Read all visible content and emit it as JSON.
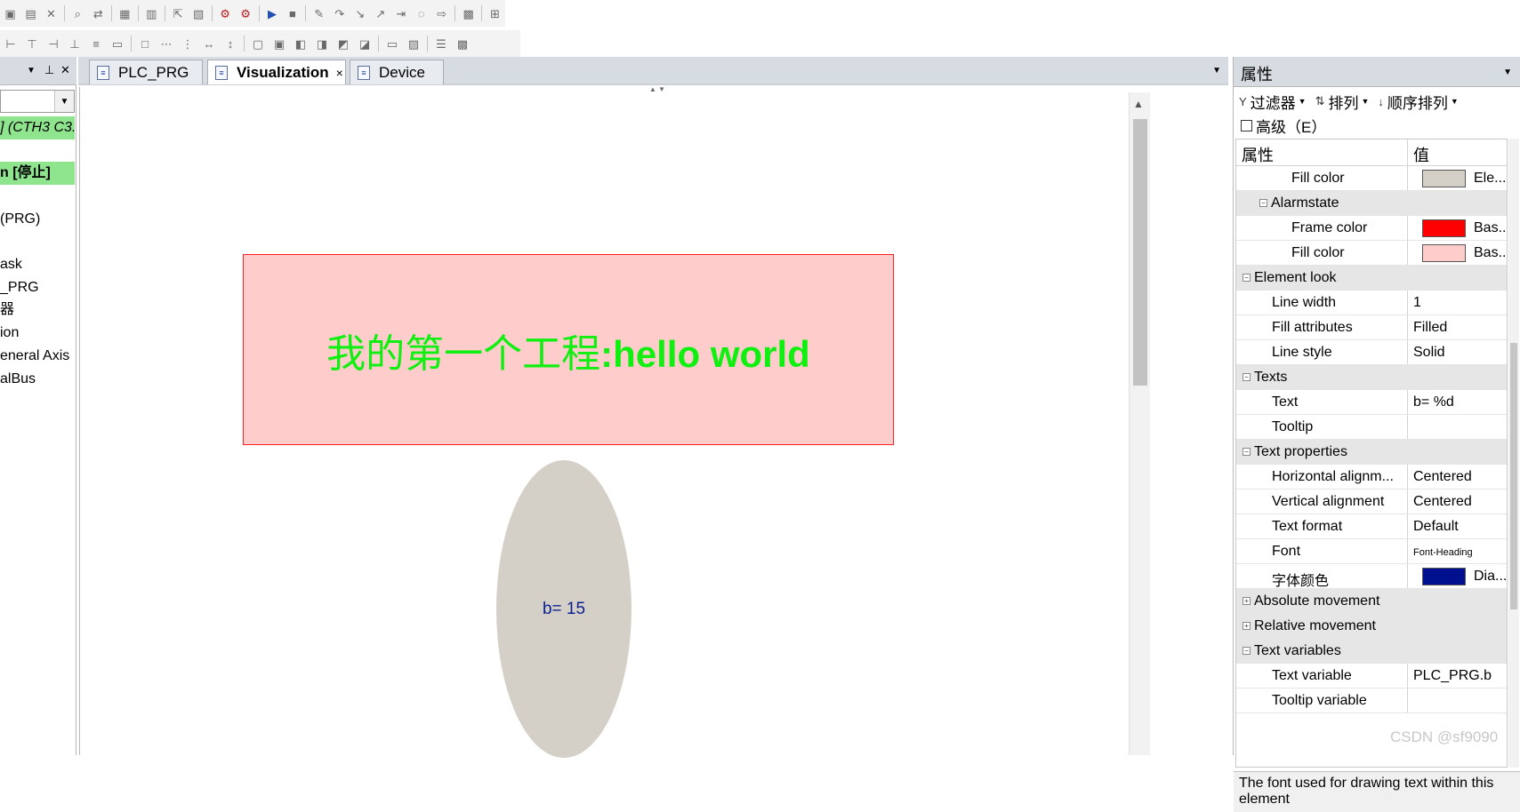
{
  "toolbar": {
    "row1_icons": [
      "paste-icon",
      "paste-special-icon",
      "delete-icon",
      "find-icon",
      "replace-icon",
      "print-icon",
      "add-object-icon",
      "export-icon",
      "monitor-icon",
      "login-icon",
      "logout-icon",
      "start-icon",
      "stop-icon",
      "build-icon",
      "step-over-icon",
      "step-into-icon",
      "step-out-icon",
      "run-to-cursor-icon",
      "breakpoint-icon",
      "next-statement-icon",
      "display-mode-icon",
      "cart-icon"
    ],
    "row2_icons": [
      "align-left-icon",
      "align-center-icon",
      "align-right-icon",
      "align-top-icon",
      "align-middle-icon",
      "align-bottom-icon",
      "same-size-icon",
      "distribute-h-icon",
      "distribute-v-icon",
      "space-h-icon",
      "space-v-icon",
      "group-icon",
      "ungroup-icon",
      "bring-front-icon",
      "send-back-icon",
      "bring-forward-icon",
      "send-backward-icon",
      "frame-icon",
      "background-icon",
      "element-list-icon",
      "config-icon"
    ]
  },
  "left_panel": {
    "tree": [
      {
        "text": "] (CTH3 C3.",
        "style": "green-italic"
      },
      {
        "text": "n [停止]",
        "style": "green-bold"
      },
      {
        "text": "(PRG)",
        "style": "normal"
      },
      {
        "text": "ask",
        "style": "normal"
      },
      {
        "text": "_PRG",
        "style": "normal"
      },
      {
        "text": "器",
        "style": "normal"
      },
      {
        "text": "ion",
        "style": "normal"
      },
      {
        "text": "eneral Axis",
        "style": "normal"
      },
      {
        "text": "alBus",
        "style": "normal"
      }
    ]
  },
  "tabs": [
    {
      "label": "PLC_PRG",
      "active": false,
      "icon": "program-icon"
    },
    {
      "label": "Visualization",
      "active": true,
      "icon": "visualization-icon",
      "close": "×"
    },
    {
      "label": "Device",
      "active": false,
      "icon": "device-icon"
    }
  ],
  "canvas": {
    "rect_text_cn": "我的第一个工程",
    "rect_text_en": ":hello world",
    "rect_fill": "#ffcccc",
    "rect_frame": "#ff2020",
    "rect_text_color": "#10f010",
    "ellipse_text": "b= 15",
    "ellipse_fill": "#d4d0c8",
    "ellipse_text_color": "#0a1f8f"
  },
  "properties": {
    "title": "属性",
    "filter_label": "过滤器",
    "sort_label": "排列",
    "order_label": "顺序排列",
    "advanced_label": "高级（E）",
    "col_name": "属性",
    "col_value": "值",
    "rows": [
      {
        "name": "Fill color",
        "level": 3,
        "type": "color",
        "color": "#d4d0c8",
        "value": "Ele..."
      },
      {
        "name": "Alarmstate",
        "level": 2,
        "type": "category",
        "toggle": "−"
      },
      {
        "name": "Frame color",
        "level": 3,
        "type": "color",
        "color": "#ff0000",
        "value": "Bas..."
      },
      {
        "name": "Fill color",
        "level": 3,
        "type": "color",
        "color": "#ffcccc",
        "value": "Bas..."
      },
      {
        "name": "Element look",
        "level": 1,
        "type": "category",
        "toggle": "−"
      },
      {
        "name": "Line width",
        "level": 2,
        "type": "text",
        "value": "1"
      },
      {
        "name": "Fill attributes",
        "level": 2,
        "type": "text",
        "value": "Filled"
      },
      {
        "name": "Line style",
        "level": 2,
        "type": "text",
        "value": "Solid"
      },
      {
        "name": "Texts",
        "level": 1,
        "type": "category",
        "toggle": "−"
      },
      {
        "name": "Text",
        "level": 2,
        "type": "text",
        "value": "b= %d"
      },
      {
        "name": "Tooltip",
        "level": 2,
        "type": "text",
        "value": ""
      },
      {
        "name": "Text properties",
        "level": 1,
        "type": "category",
        "toggle": "−"
      },
      {
        "name": "Horizontal alignm...",
        "level": 2,
        "type": "text",
        "value": "Centered"
      },
      {
        "name": "Vertical alignment",
        "level": 2,
        "type": "text",
        "value": "Centered"
      },
      {
        "name": "Text format",
        "level": 2,
        "type": "text",
        "value": "Default"
      },
      {
        "name": "Font",
        "level": 2,
        "type": "small",
        "value": "Font-Heading"
      },
      {
        "name": "字体颜色",
        "level": 2,
        "type": "color",
        "color": "#00108f",
        "value": "Dia..."
      },
      {
        "name": "Absolute movement",
        "level": 1,
        "type": "category",
        "toggle": "+"
      },
      {
        "name": "Relative movement",
        "level": 1,
        "type": "category",
        "toggle": "+"
      },
      {
        "name": "Text variables",
        "level": 1,
        "type": "category",
        "toggle": "−"
      },
      {
        "name": "Text variable",
        "level": 2,
        "type": "text",
        "value": "PLC_PRG.b"
      },
      {
        "name": "Tooltip variable",
        "level": 2,
        "type": "text",
        "value": ""
      }
    ],
    "description": "The font used for drawing text within this element"
  },
  "watermark": "CSDN @sf9090"
}
